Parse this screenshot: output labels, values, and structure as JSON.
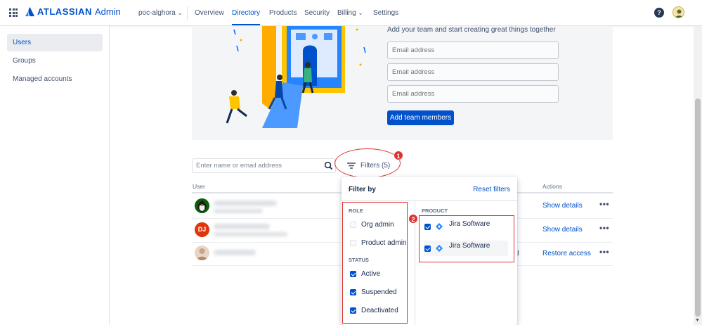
{
  "nav": {
    "brand": "ATLASSIAN",
    "product": "Admin",
    "org": "poc-alghora",
    "items": [
      "Overview",
      "Directory",
      "Products",
      "Security",
      "Billing",
      "Settings"
    ],
    "active": "Directory",
    "help": "?"
  },
  "sidebar": {
    "items": [
      {
        "label": "Users",
        "active": true
      },
      {
        "label": "Groups"
      },
      {
        "label": "Managed accounts"
      }
    ]
  },
  "invite": {
    "text": "Add your team and start creating great things together",
    "email_placeholder": "Email address",
    "button": "Add team members"
  },
  "search": {
    "placeholder": "Enter name or email address",
    "filters_label": "Filters (5)"
  },
  "table": {
    "headers": {
      "user": "User",
      "actions": "Actions"
    },
    "rows": [
      {
        "avatar": "tux",
        "action": "Show details"
      },
      {
        "avatar_initials": "DJ",
        "action": "Show details"
      },
      {
        "avatar": "photo",
        "status_fragment": "d",
        "action": "Restore access"
      }
    ]
  },
  "filter_panel": {
    "title": "Filter by",
    "reset": "Reset filters",
    "role_header": "ROLE",
    "roles": [
      {
        "label": "Org admin",
        "checked": false
      },
      {
        "label": "Product admin",
        "checked": false
      }
    ],
    "status_header": "STATUS",
    "statuses": [
      {
        "label": "Active",
        "checked": true
      },
      {
        "label": "Suspended",
        "checked": true
      },
      {
        "label": "Deactivated",
        "checked": true
      }
    ],
    "product_header": "PRODUCT",
    "products": [
      {
        "label": "Jira Software",
        "checked": true
      },
      {
        "label": "Jira Software",
        "checked": true
      }
    ]
  },
  "annotations": {
    "badge1": "1",
    "badge2": "2"
  },
  "colors": {
    "primary": "#0052cc",
    "annotation": "#dd3333",
    "text": "#172b4d"
  }
}
